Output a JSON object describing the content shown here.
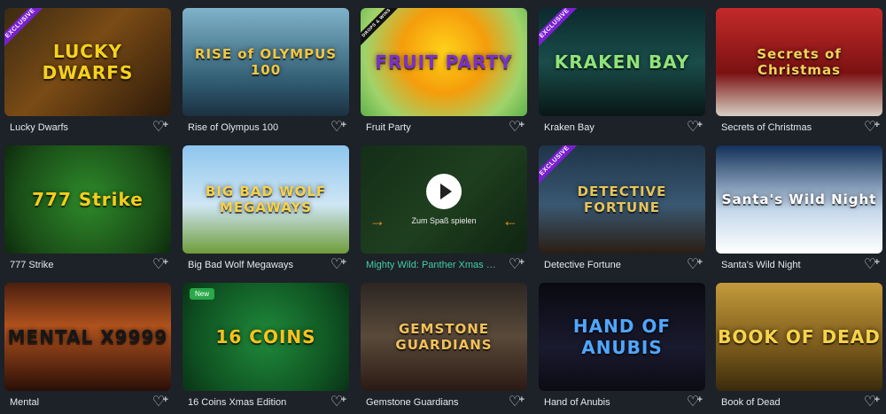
{
  "games": [
    {
      "name": "Lucky Dwarfs",
      "logo": "LUCKY DWARFS",
      "badge": "EXCLUSIVE",
      "bg": "linear-gradient(135deg,#3b2a12,#7a4b15 45%,#2c1a0a)",
      "logo_color": "#f5d21c"
    },
    {
      "name": "Rise of Olympus 100",
      "logo": "RISE of OLYMPUS 100",
      "bg": "linear-gradient(180deg,#7fb3c9,#2f5a70 70%,#1c3140)",
      "logo_color": "#f3c640"
    },
    {
      "name": "Fruit Party",
      "logo": "FRUIT PARTY",
      "badge": "DROPS & WINS",
      "bg": "radial-gradient(circle at 50% 40%,#ffd21a,#f59d0b 40%,#9fd36b 75%,#5fb04a)",
      "logo_color": "#7b2fd0"
    },
    {
      "name": "Kraken Bay",
      "logo": "KRAKEN BAY",
      "badge": "EXCLUSIVE",
      "bg": "linear-gradient(180deg,#0c2a2e,#1a4d4a 50%,#081716)",
      "logo_color": "#8fe37a"
    },
    {
      "name": "Secrets of Christmas",
      "logo": "Secrets of Christmas",
      "bg": "linear-gradient(180deg,#c42a2a,#7b1212 60%,#d8d0c4)",
      "logo_color": "#f3d35a"
    },
    {
      "name": "777 Strike",
      "logo": "777 Strike",
      "bg": "radial-gradient(circle at 50% 50%,#2e8a2a,#1a4d17 70%,#0e2a0d)",
      "logo_color": "#f5cd1c"
    },
    {
      "name": "Big Bad Wolf Megaways",
      "logo": "BIG BAD WOLF MEGAWAYS",
      "bg": "linear-gradient(180deg,#8ec6ee,#cfe6f4 55%,#6f9c3a)",
      "logo_color": "#f6d24a"
    },
    {
      "name": "Mighty Wild: Panther Xmas Edition",
      "logo": "",
      "bg": "linear-gradient(135deg,#1c3a20,#2f5a2c 50%,#152915)",
      "logo_color": "#ffffff",
      "overlay": {
        "label": "Zum Spaß spielen"
      }
    },
    {
      "name": "Detective Fortune",
      "logo": "DETECTIVE FORTUNE",
      "badge": "EXCLUSIVE",
      "bg": "linear-gradient(180deg,#1e3448,#3a5872 55%,#2a1d12)",
      "logo_color": "#e6c45a"
    },
    {
      "name": "Santa's Wild Night",
      "logo": "Santa's Wild Night",
      "bg": "linear-gradient(180deg,#12305a,#c4d7ea 60%,#ffffff)",
      "logo_color": "#ffffff"
    },
    {
      "name": "Mental",
      "logo": "MENTAL X9999",
      "bg": "linear-gradient(180deg,#4a1f0f,#b0521d 40%,#2a0f08)",
      "logo_color": "#171717"
    },
    {
      "name": "16 Coins Xmas Edition",
      "logo": "16 COINS",
      "badge_new": "New",
      "bg": "radial-gradient(circle at 50% 50%,#1f8a3a,#0f5222 70%,#0a3216)",
      "logo_color": "#f6c21c"
    },
    {
      "name": "Gemstone Guardians",
      "logo": "GEMSTONE GUARDIANS",
      "bg": "linear-gradient(180deg,#2c2622,#5a4a3a 50%,#2a1a14)",
      "logo_color": "#f1c15a"
    },
    {
      "name": "Hand of Anubis",
      "logo": "HAND OF ANUBIS",
      "bg": "linear-gradient(180deg,#0a0a12,#1a1a2e 60%,#0b0b14)",
      "logo_color": "#4fa7ff"
    },
    {
      "name": "Book of Dead",
      "logo": "BOOK OF DEAD",
      "bg": "linear-gradient(180deg,#c49a3a,#7a5a1c 60%,#3a2a0c)",
      "logo_color": "#f7d34a"
    }
  ],
  "icons": {
    "favorite": "heart-plus-icon"
  }
}
